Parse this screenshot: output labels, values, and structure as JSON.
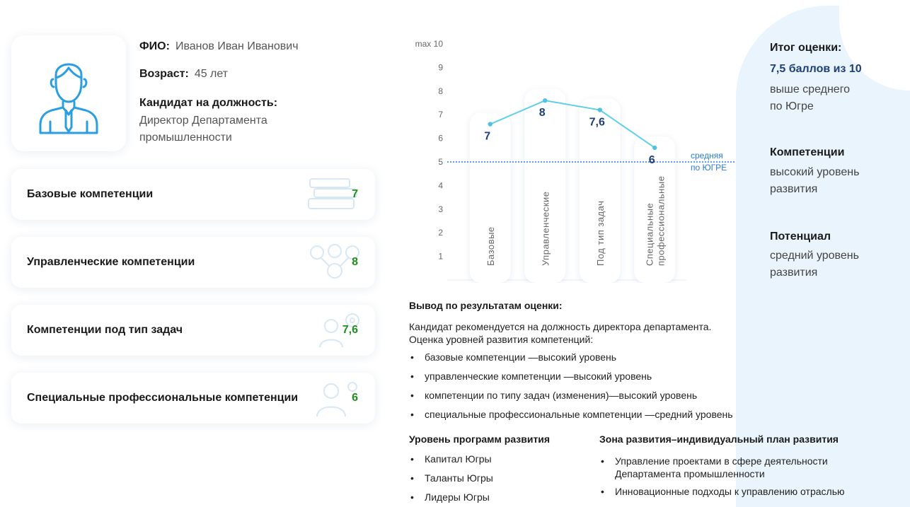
{
  "profile": {
    "name_label": "ФИО:",
    "name": "Иванов Иван Иванович",
    "age_label": "Возраст:",
    "age": "45 лет",
    "position_label": "Кандидат на должность:",
    "position_line1": "Директор Департамента",
    "position_line2": "промышленности"
  },
  "competencies": [
    {
      "label": "Базовые компетенции",
      "score": "7"
    },
    {
      "label": "Управленческие компетенции",
      "score": "8"
    },
    {
      "label": "Компетенции под тип задач",
      "score": "7,6"
    },
    {
      "label": "Специальные профессиональные компетенции",
      "score": "6"
    }
  ],
  "chart_data": {
    "type": "line",
    "ylim": [
      0,
      10
    ],
    "y_ticks": [
      "1",
      "2",
      "3",
      "4",
      "5",
      "6",
      "7",
      "8",
      "9"
    ],
    "y_max_label": "max 10",
    "categories": [
      "Базовые",
      "Управленческие",
      "Под тип задач",
      "Специальные профессиональные"
    ],
    "category_lines": [
      [
        "Базовые"
      ],
      [
        "Управленческие"
      ],
      [
        "Под тип задач"
      ],
      [
        "Специальные",
        "профессиональные"
      ]
    ],
    "values": [
      6.6,
      7.6,
      7.2,
      5.6
    ],
    "value_labels": [
      "7",
      "8",
      "7,6",
      "6"
    ],
    "reference": {
      "value": 5,
      "label_line1": "средняя",
      "label_line2": "по ЮГРЕ"
    },
    "colors": {
      "line": "#5ecfea",
      "point": "#4fc2e3",
      "value_label": "#1e3f7a",
      "reference": "#2b7bd8",
      "axis_text": "#666666"
    }
  },
  "conclusion": {
    "title": "Вывод по результатам оценки:",
    "line1": "Кандидат рекомендуется на должность директора департамента.",
    "line2": "Оценка уровней развития компетенций:",
    "items": [
      "базовые компетенции —высокий уровень",
      "управленческие компетенции —высокий уровень",
      "компетенции по типу задач (изменения)—высокий уровень",
      "специальные профессиональные компетенции —средний уровень"
    ]
  },
  "programs": {
    "title": "Уровень программ развития",
    "items": [
      "Капитал Югры",
      "Таланты Югры",
      "Лидеры Югры"
    ]
  },
  "zone": {
    "title": "Зона развития–индивидуальный план развития",
    "item1_line1": "Управление проектами в сфере деятельности",
    "item1_line2": "Департамента промышленности",
    "item2": "Инновационные подходы к управлению отраслью"
  },
  "summary": {
    "total_title": "Итог оценки:",
    "total_value": "7,5 баллов из 10",
    "total_note_line1": "выше среднего",
    "total_note_line2": "по Югре",
    "comp_title": "Компетенции",
    "comp_line1": "высокий уровень",
    "comp_line2": "развития",
    "potential_title": "Потенциал",
    "potential_line1": "средний уровень",
    "potential_line2": "развития"
  },
  "colors": {
    "score_green": "#1f8f1f",
    "accent_blue": "#1e3f7a",
    "icon_blue": "#2a9fe0",
    "background_shape": "#eaf4fc"
  }
}
